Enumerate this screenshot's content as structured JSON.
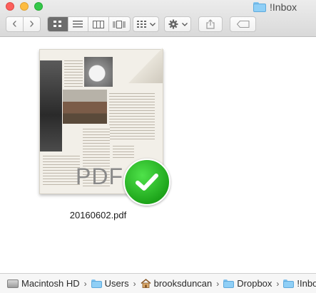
{
  "window": {
    "title": "!Inbox"
  },
  "toolbar": {
    "back": "‹",
    "forward": "›",
    "views": [
      "icon-view",
      "list-view",
      "column-view",
      "cover-flow-view"
    ],
    "active_view": "icon-view"
  },
  "file": {
    "name": "20160602.pdf",
    "doc_label": "PDF"
  },
  "pathbar": {
    "items": [
      {
        "label": "Macintosh HD",
        "icon": "hard-drive-icon"
      },
      {
        "label": "Users",
        "icon": "folder-icon"
      },
      {
        "label": "brooksduncan",
        "icon": "home-icon"
      },
      {
        "label": "Dropbox",
        "icon": "dropbox-folder-icon"
      },
      {
        "label": "!Inbox",
        "icon": "folder-icon"
      }
    ],
    "separator": "›"
  },
  "colors": {
    "badge": "#1ea51b",
    "folder": "#8fcff6",
    "accent_active": "#6d6d6d"
  }
}
